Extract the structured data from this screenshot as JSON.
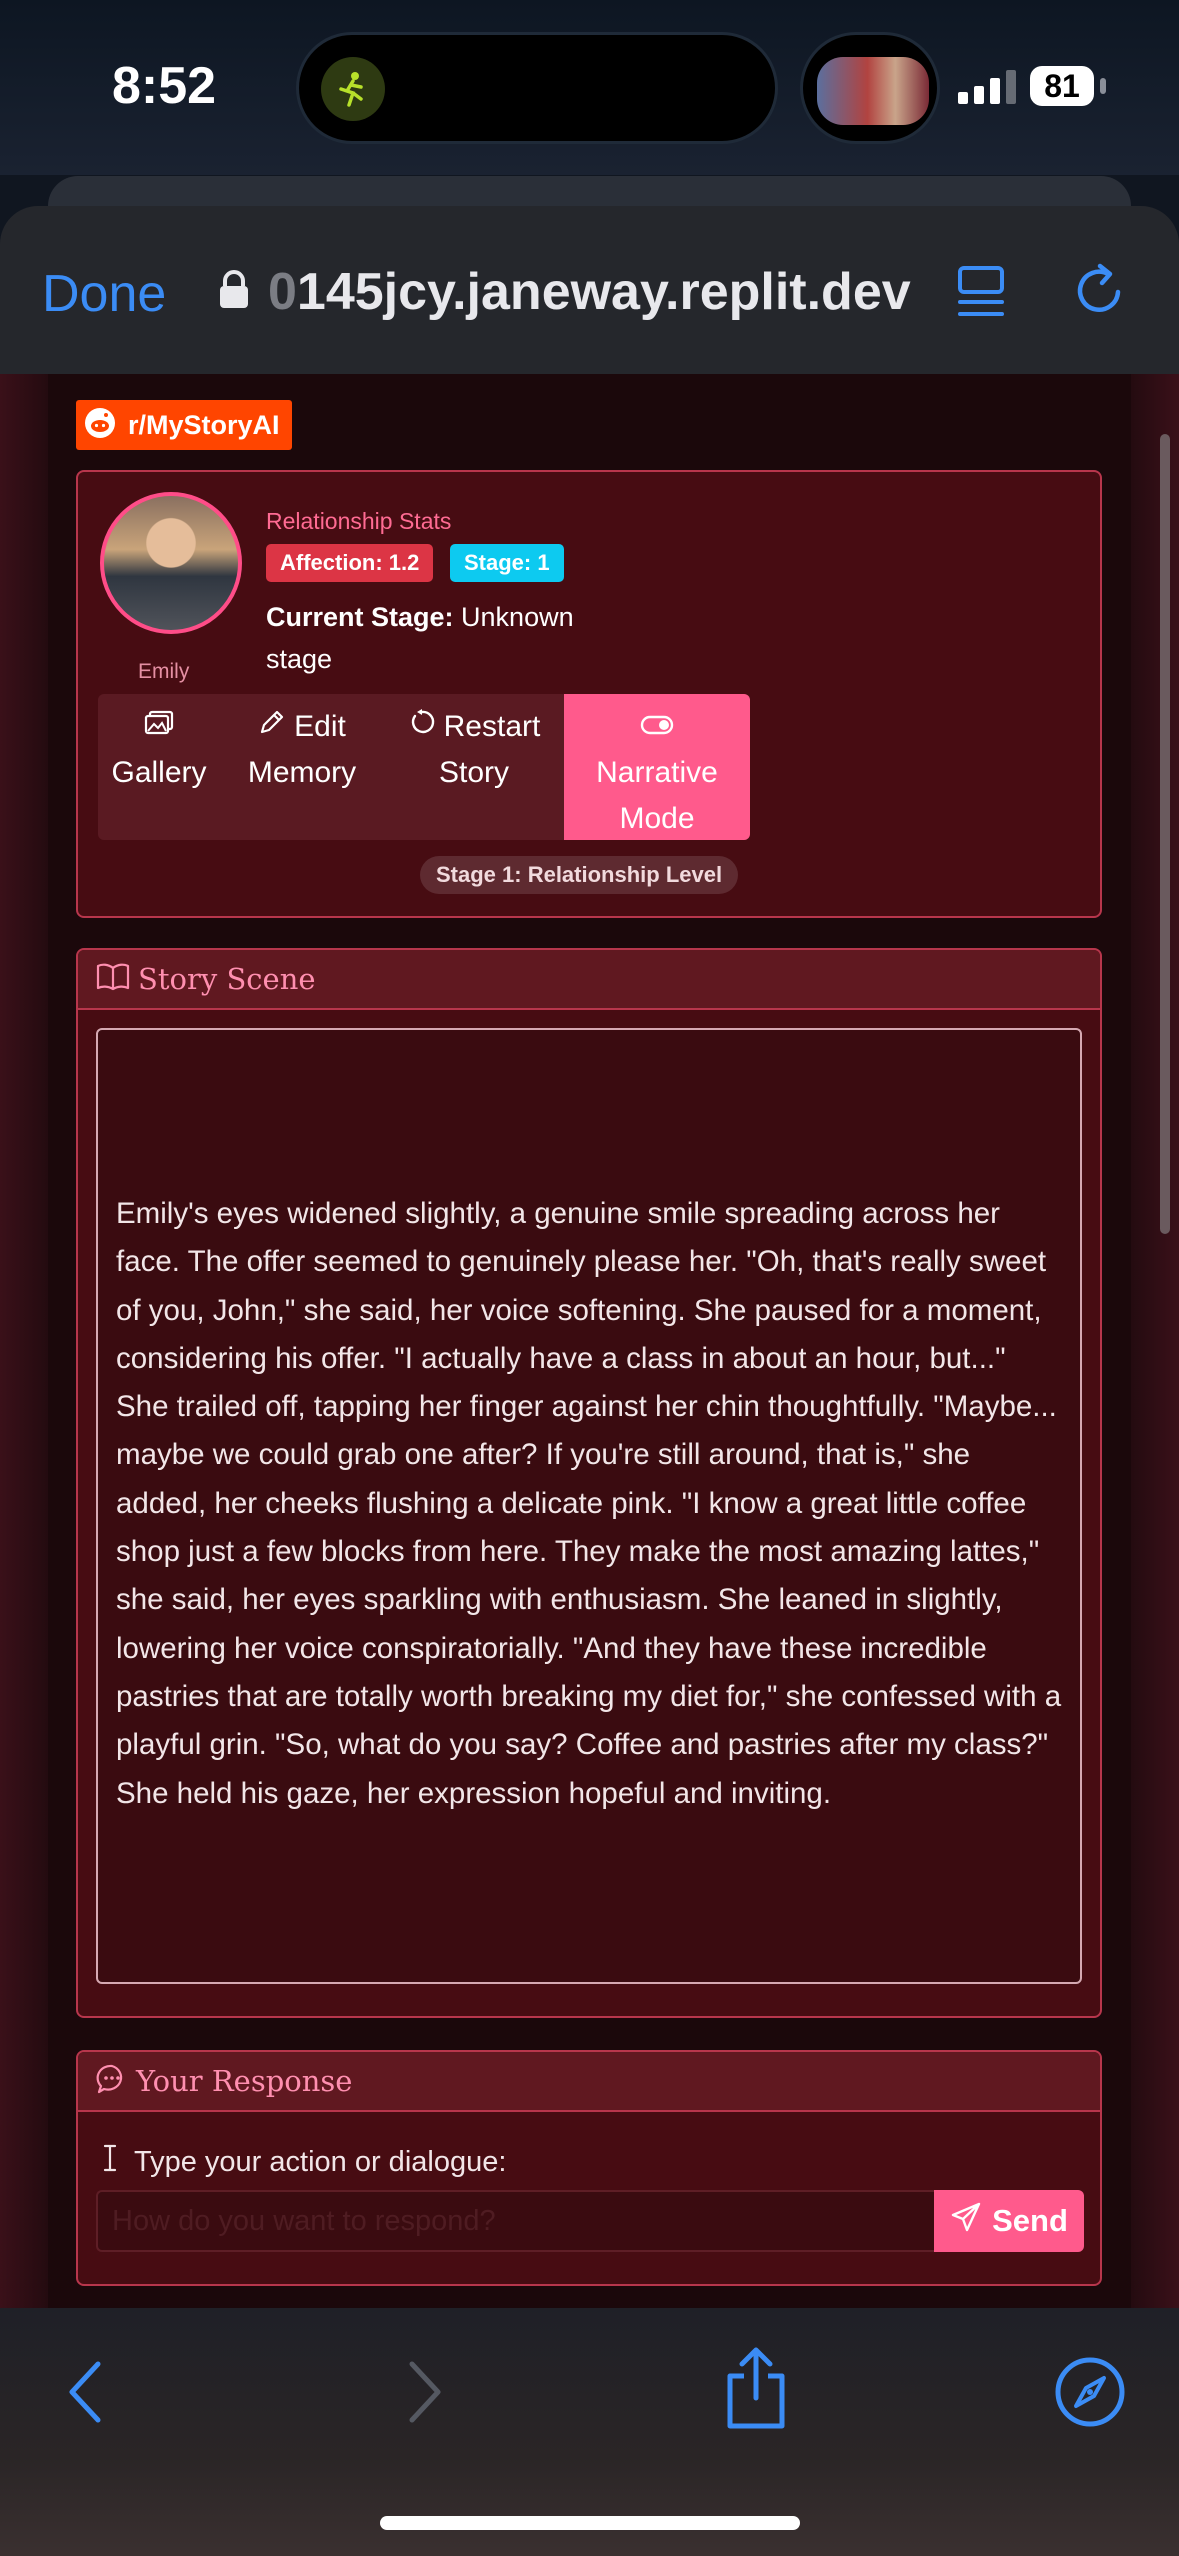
{
  "status_bar": {
    "time": "8:52",
    "battery": "81"
  },
  "browser": {
    "done_label": "Done",
    "url_faded": "0",
    "url": "145jcy.janeway.replit.dev"
  },
  "page": {
    "subreddit_badge": "r/MyStoryAI",
    "profile": {
      "name": "Emily",
      "stats_title": "Relationship Stats",
      "affection_badge": "Affection: 1.2",
      "stage_badge": "Stage: 1",
      "current_stage_label": "Current Stage:",
      "current_stage_value": "Unknown stage"
    },
    "actions": {
      "gallery": "Gallery",
      "edit_line1": "Edit",
      "edit_line2": "Memory",
      "restart_line1": "Restart",
      "restart_line2": "Story",
      "narrative_line1": "Narrative",
      "narrative_line2": "Mode"
    },
    "stage_pill": "Stage 1: Relationship Level",
    "scene": {
      "header": "Story Scene",
      "text": "Emily's eyes widened slightly, a genuine smile spreading across her face. The offer seemed to genuinely please her. \"Oh, that's really sweet of you, John,\" she said, her voice softening. She paused for a moment, considering his offer. \"I actually have a class in about an hour, but...\" She trailed off, tapping her finger against her chin thoughtfully. \"Maybe... maybe we could grab one after? If you're still around, that is,\" she added, her cheeks flushing a delicate pink. \"I know a great little coffee shop just a few blocks from here. They make the most amazing lattes,\" she said, her eyes sparkling with enthusiasm. She leaned in slightly, lowering her voice conspiratorially. \"And they have these incredible pastries that are totally worth breaking my diet for,\" she confessed with a playful grin. \"So, what do you say? Coffee and pastries after my class?\" She held his gaze, her expression hopeful and inviting."
    },
    "response": {
      "header": "Your Response",
      "label": "Type your action or dialogue:",
      "placeholder": "How do you want to respond?",
      "value": "",
      "send": "Send"
    }
  },
  "colors": {
    "accent_pink": "#ff5a8c",
    "browser_blue": "#3b8cf5",
    "card_bg": "#470c12",
    "card_border": "#b8364c",
    "affection_red": "#dc3545",
    "stage_cyan": "#0dcaf0",
    "reddit_orange": "#ff4500"
  },
  "icons": {
    "lock": "lock-icon",
    "tabs": "tabs-icon",
    "reload": "reload-icon",
    "gallery": "image-icon",
    "edit": "pencil-icon",
    "restart": "restart-icon",
    "narrative": "toggle-icon",
    "scene": "book-icon",
    "response": "chat-bubble-icon",
    "cursor": "text-cursor-icon",
    "send": "paper-plane-icon",
    "back": "chevron-left-icon",
    "forward": "chevron-right-icon",
    "share": "share-icon",
    "compass": "compass-icon"
  }
}
